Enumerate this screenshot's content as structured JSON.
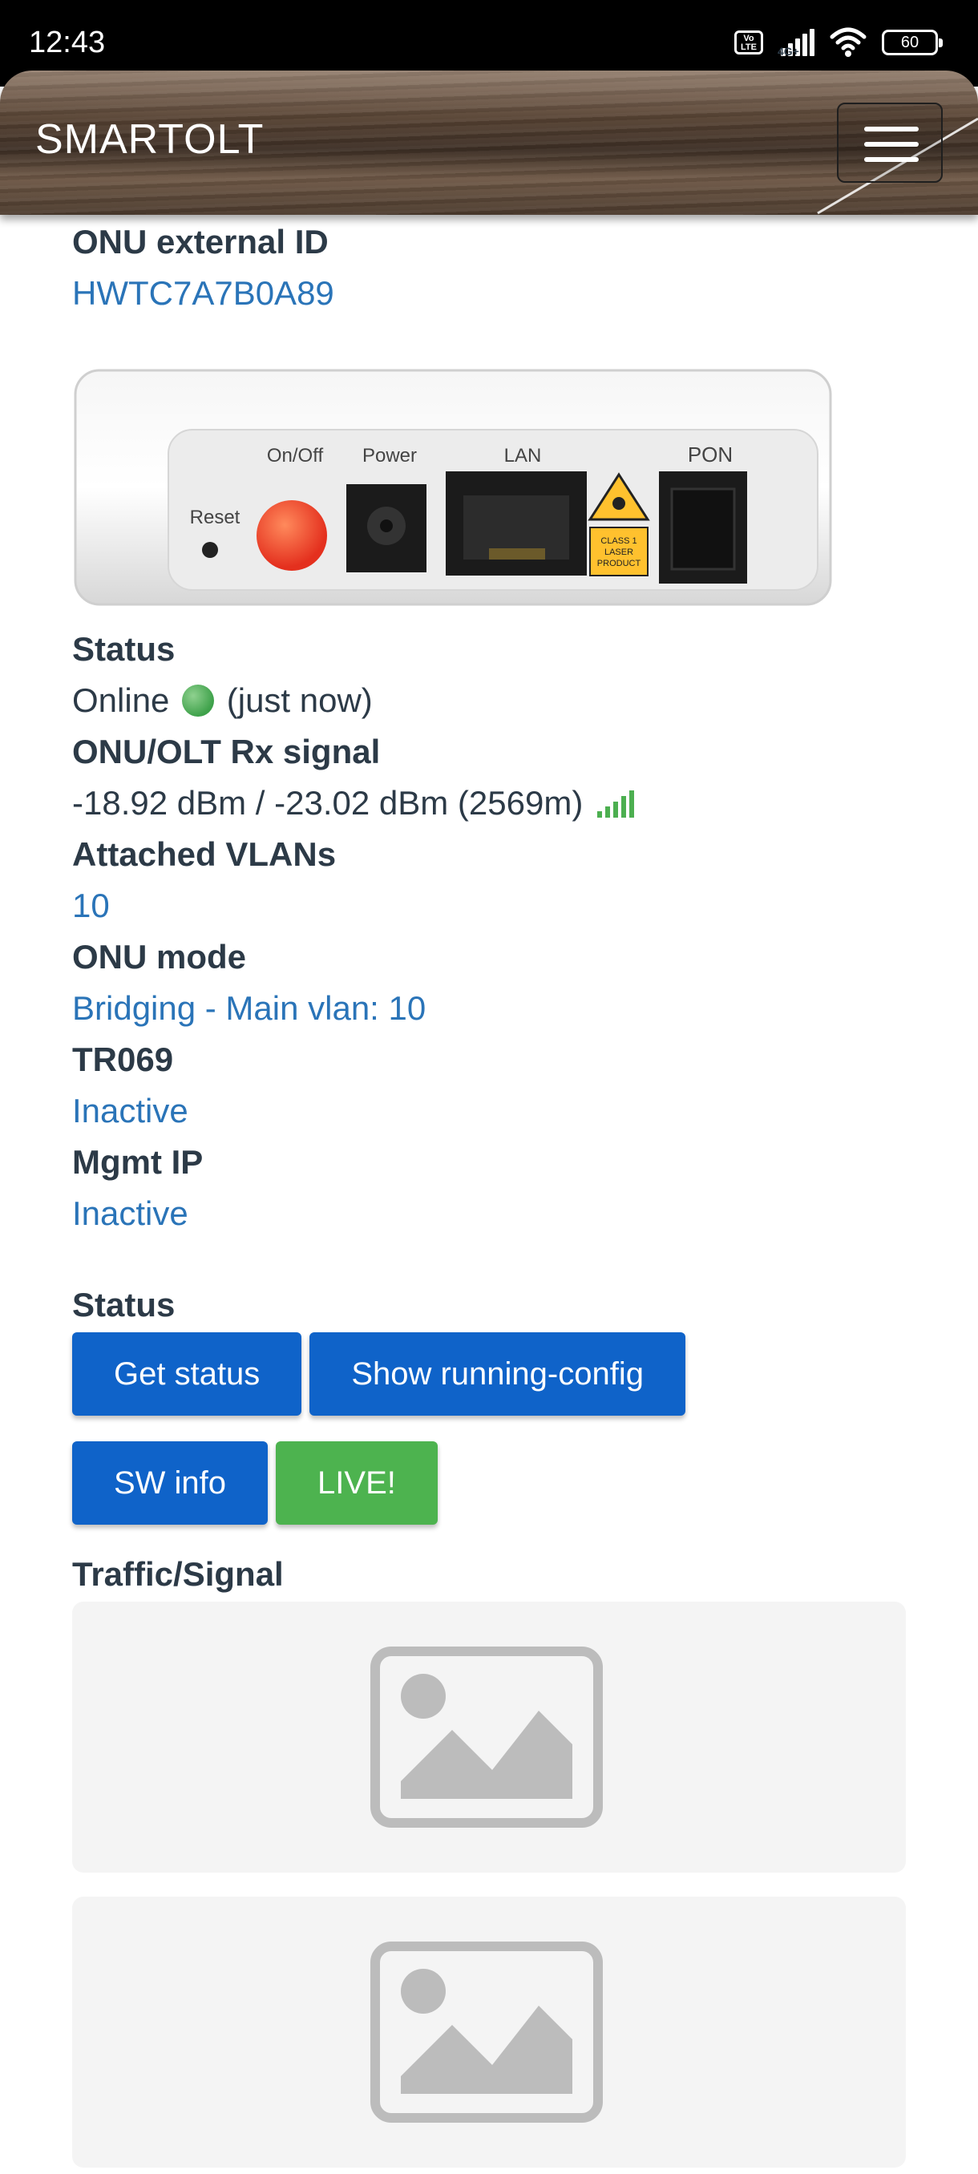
{
  "status_bar": {
    "time": "12:43",
    "volte_label": "Vo LTE",
    "network_label": "4G+",
    "battery_level": "60"
  },
  "navbar": {
    "brand": "SMARTOLT",
    "menu_icon": "hamburger-icon"
  },
  "onu": {
    "external_id_label": "ONU external ID",
    "external_id_value": "HWTC7A7B0A89",
    "device_image": {
      "port_labels": [
        "Reset",
        "On/Off",
        "Power",
        "LAN",
        "PON"
      ],
      "laser_label": [
        "CLASS 1",
        "LASER",
        "PRODUCT"
      ]
    },
    "status_label": "Status",
    "status_value": "Online",
    "status_time": "(just now)",
    "signal_label": "ONU/OLT Rx signal",
    "signal_value": "-18.92 dBm / -23.02 dBm (2569m)",
    "vlans_label": "Attached VLANs",
    "vlans_value": "10",
    "mode_label": "ONU mode",
    "mode_value": "Bridging - Main vlan: 10",
    "tr069_label": "TR069",
    "tr069_value": "Inactive",
    "mgmt_ip_label": "Mgmt IP",
    "mgmt_ip_value": "Inactive"
  },
  "actions": {
    "section_label": "Status",
    "get_status": "Get status",
    "show_running_config": "Show running-config",
    "sw_info": "SW info",
    "live": "LIVE!"
  },
  "traffic": {
    "section_label": "Traffic/Signal",
    "placeholder_icon": "image-placeholder-icon"
  },
  "colors": {
    "link": "#2a74b8",
    "button_blue": "#0f63c9",
    "button_green": "#4db34f",
    "online_green": "#3ea14a"
  }
}
